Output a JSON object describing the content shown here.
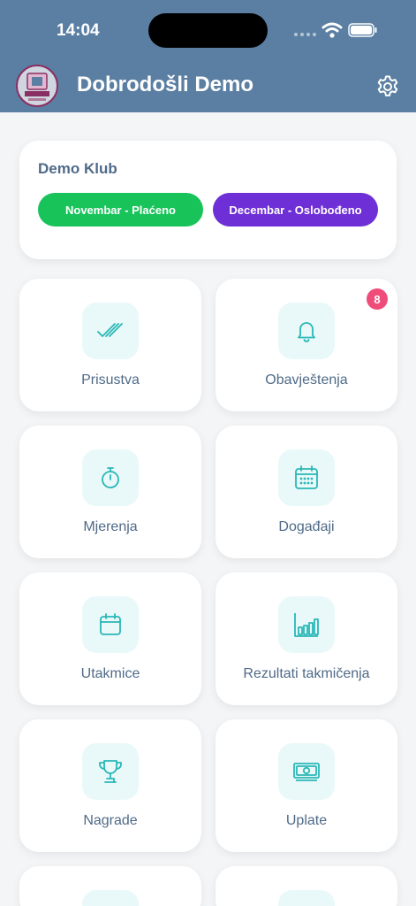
{
  "status_bar": {
    "time": "14:04"
  },
  "header": {
    "title": "Dobrodošli Demo"
  },
  "club": {
    "name": "Demo Klub",
    "months": [
      {
        "label": "Novembar - Plaćeno",
        "color": "#18c35a"
      },
      {
        "label": "Decembar - Oslobođeno",
        "color": "#6f2fd6"
      }
    ]
  },
  "tiles": [
    {
      "label": "Prisustva",
      "icon": "double-check-icon"
    },
    {
      "label": "Obavještenja",
      "icon": "bell-icon",
      "badge": "8"
    },
    {
      "label": "Mjerenja",
      "icon": "stopwatch-icon"
    },
    {
      "label": "Događaji",
      "icon": "calendar-grid-icon"
    },
    {
      "label": "Utakmice",
      "icon": "calendar-icon"
    },
    {
      "label": "Rezultati takmičenja",
      "icon": "bar-chart-icon"
    },
    {
      "label": "Nagrade",
      "icon": "trophy-icon"
    },
    {
      "label": "Uplate",
      "icon": "money-icon"
    }
  ],
  "colors": {
    "header": "#5b7fa3",
    "accent": "#2ab7b7",
    "text": "#4f6a88",
    "badge": "#f04c79"
  }
}
